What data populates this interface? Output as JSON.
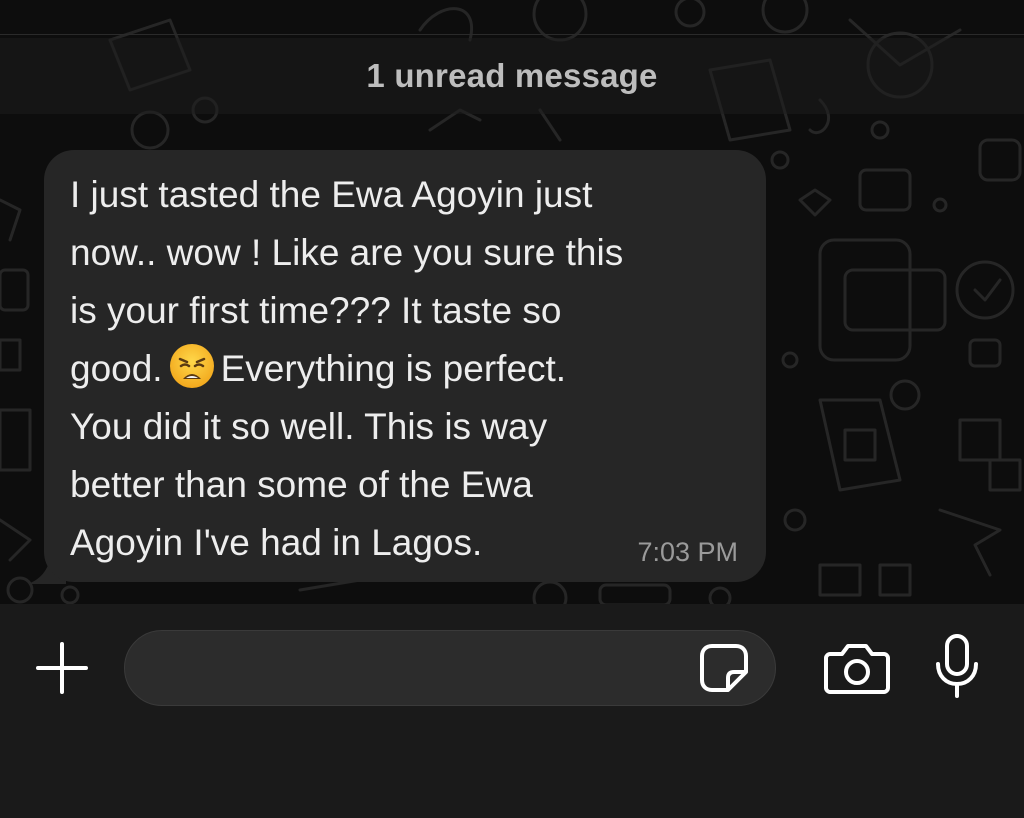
{
  "banner": {
    "unread_label": "1 unread message"
  },
  "message": {
    "lines": [
      "I just tasted the Ewa Agoyin just",
      "now.. wow ! Like are you sure this",
      "is your first time??? It taste so",
      "good.",
      "Everything is perfect.",
      "You did it so well. This is way",
      "better than some of the Ewa",
      "Agoyin I've had in Lagos."
    ],
    "emoji": "weary-face-emoji",
    "time": "7:03 PM"
  },
  "composer": {
    "input_value": "",
    "input_placeholder": "",
    "icons": {
      "add": "plus-icon",
      "sticker": "sticker-icon",
      "camera": "camera-icon",
      "mic": "microphone-icon"
    }
  },
  "colors": {
    "background": "#0d0d0d",
    "bubble": "#262626",
    "composer": "#1a1a1a",
    "text": "#ededed",
    "muted": "#9a9a9a"
  }
}
